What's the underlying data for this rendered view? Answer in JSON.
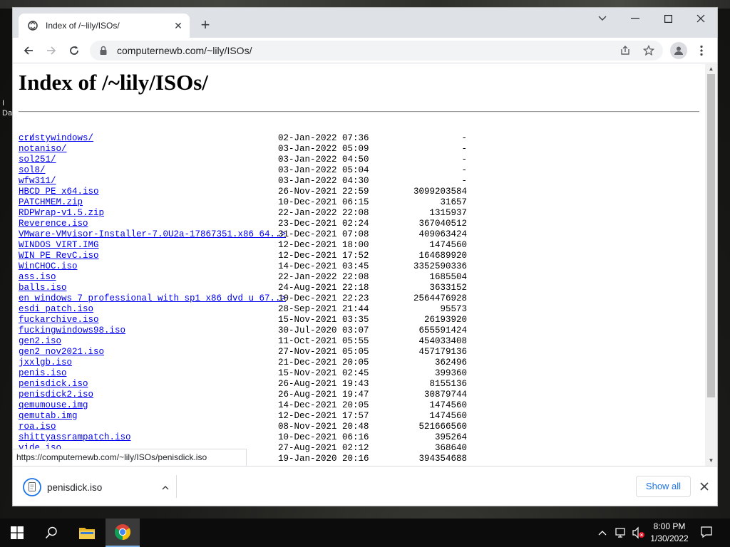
{
  "desktop": {
    "fragment_text": "Da"
  },
  "tab": {
    "title": "Index of /~lily/ISOs/"
  },
  "toolbar": {
    "url": "computernewb.com/~lily/ISOs/"
  },
  "page": {
    "heading": "Index of /~lily/ISOs/",
    "parent_link": "../",
    "entries": [
      {
        "name": "crustywindows/",
        "date": "02-Jan-2022 07:36",
        "size": "-"
      },
      {
        "name": "notaniso/",
        "date": "03-Jan-2022 05:09",
        "size": "-"
      },
      {
        "name": "sol251/",
        "date": "03-Jan-2022 04:50",
        "size": "-"
      },
      {
        "name": "sol8/",
        "date": "03-Jan-2022 05:04",
        "size": "-"
      },
      {
        "name": "wfw311/",
        "date": "03-Jan-2022 04:30",
        "size": "-"
      },
      {
        "name": "HBCD_PE_x64.iso",
        "date": "26-Nov-2021 22:59",
        "size": "3099203584"
      },
      {
        "name": "PATCHMEM.zip",
        "date": "10-Dec-2021 06:15",
        "size": "31657"
      },
      {
        "name": "RDPWrap-v1.5.zip",
        "date": "22-Jan-2022 22:08",
        "size": "1315937"
      },
      {
        "name": "Reverence.iso",
        "date": "23-Dec-2021 02:24",
        "size": "367040512"
      },
      {
        "name": "VMware-VMvisor-Installer-7.0U2a-17867351.x86_64..>",
        "date": "31-Dec-2021 07:08",
        "size": "409063424"
      },
      {
        "name": "WINDOS_VIRT.IMG",
        "date": "12-Dec-2021 18:00",
        "size": "1474560"
      },
      {
        "name": "WIN_PE_RevC.iso",
        "date": "12-Dec-2021 17:52",
        "size": "164689920"
      },
      {
        "name": "WinCHOC.iso",
        "date": "14-Dec-2021 03:45",
        "size": "3352590336"
      },
      {
        "name": "ass.iso",
        "date": "22-Jan-2022 22:08",
        "size": "1685504"
      },
      {
        "name": "balls.iso",
        "date": "24-Aug-2021 22:18",
        "size": "3633152"
      },
      {
        "name": "en_windows_7_professional_with_sp1_x86_dvd_u_67..>",
        "date": "10-Dec-2021 22:23",
        "size": "2564476928"
      },
      {
        "name": "esdi_patch.iso",
        "date": "28-Sep-2021 21:44",
        "size": "95573"
      },
      {
        "name": "fuckarchive.iso",
        "date": "15-Nov-2021 03:35",
        "size": "26193920"
      },
      {
        "name": "fuckingwindows98.iso",
        "date": "30-Jul-2020 03:07",
        "size": "655591424"
      },
      {
        "name": "gen2.iso",
        "date": "11-Oct-2021 05:55",
        "size": "454033408"
      },
      {
        "name": "gen2_nov2021.iso",
        "date": "27-Nov-2021 05:05",
        "size": "457179136"
      },
      {
        "name": "jxxlgb.iso",
        "date": "21-Dec-2021 20:05",
        "size": "362496"
      },
      {
        "name": "penis.iso",
        "date": "15-Nov-2021 02:45",
        "size": "399360"
      },
      {
        "name": "penisdick.iso",
        "date": "26-Aug-2021 19:43",
        "size": "8155136"
      },
      {
        "name": "penisdick2.iso",
        "date": "26-Aug-2021 19:47",
        "size": "30879744"
      },
      {
        "name": "qemumouse.img",
        "date": "14-Dec-2021 20:05",
        "size": "1474560"
      },
      {
        "name": "qemutab.img",
        "date": "12-Dec-2021 17:57",
        "size": "1474560"
      },
      {
        "name": "roa.iso",
        "date": "08-Nov-2021 20:48",
        "size": "521666560"
      },
      {
        "name": "shittyassrampatch.iso",
        "date": "10-Dec-2021 06:16",
        "size": "395264"
      },
      {
        "name": "vide.iso",
        "date": "27-Aug-2021 02:12",
        "size": "368640"
      },
      {
        "name": "",
        "date": "19-Jan-2020 20:16",
        "size": "394354688"
      }
    ]
  },
  "status_url": "https://computernewb.com/~lily/ISOs/penisdick.iso",
  "downloads": {
    "item_name": "penisdick.iso",
    "show_all_label": "Show all"
  },
  "taskbar": {
    "time": "8:00 PM",
    "date": "1/30/2022"
  },
  "icons": {
    "favicon": "page-favicon-icon",
    "lock": "lock-icon",
    "share": "share-icon",
    "star": "bookmark-star-icon",
    "profile": "profile-icon",
    "menu": "kebab-menu-icon"
  },
  "colors": {
    "link": "#0000ee",
    "accent": "#1a73e8",
    "tabstrip": "#dee1e6"
  }
}
